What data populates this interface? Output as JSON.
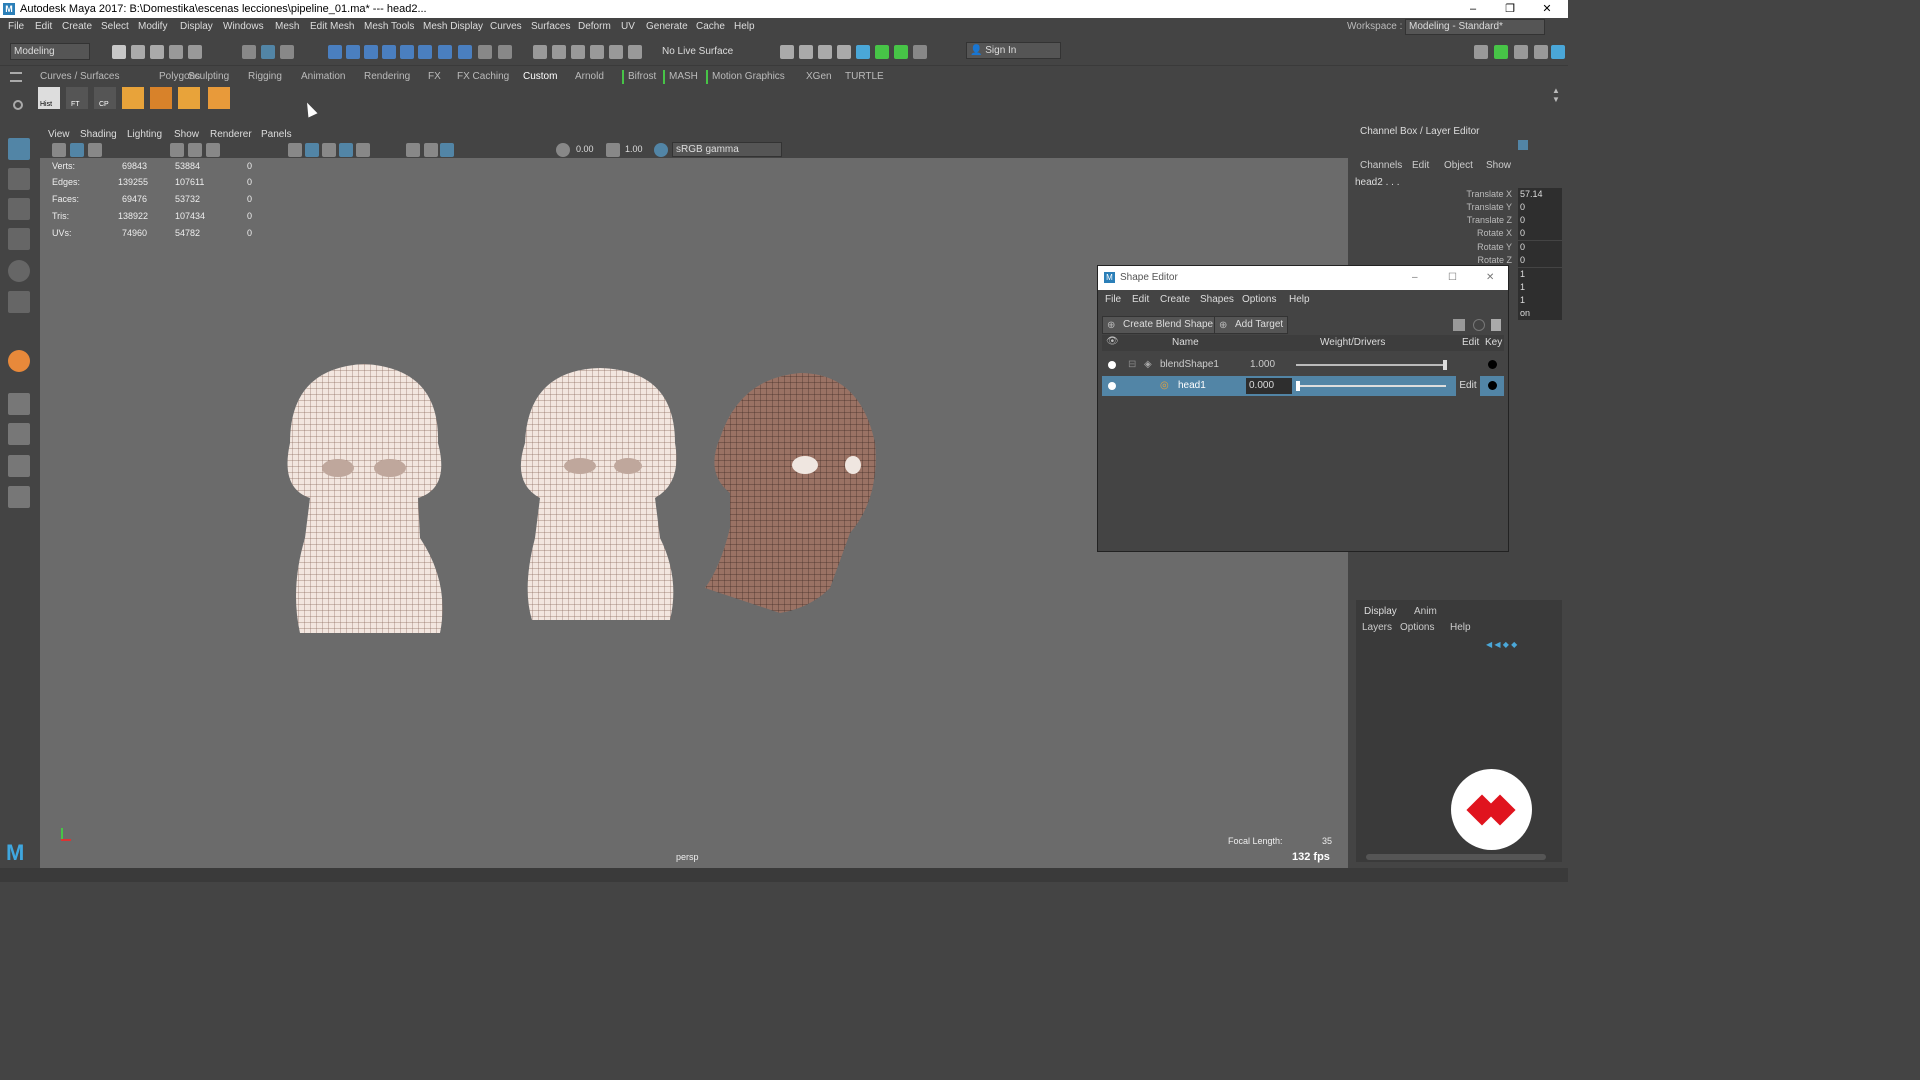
{
  "window": {
    "title": "Autodesk Maya 2017: B:\\Domestika\\escenas lecciones\\pipeline_01.ma*   ---   head2...",
    "logo": "M",
    "buttons": {
      "min": "–",
      "restore": "❐",
      "close": "✕"
    }
  },
  "menubar": {
    "items": [
      "File",
      "Edit",
      "Create",
      "Select",
      "Modify",
      "Display",
      "Windows",
      "Mesh",
      "Edit Mesh",
      "Mesh Tools",
      "Mesh Display",
      "Curves",
      "Surfaces",
      "Deform",
      "UV",
      "Generate",
      "Cache",
      "Help"
    ],
    "workspace_label": "Workspace :",
    "workspace_value": "Modeling - Standard*"
  },
  "toolbar": {
    "mode": "Modeling",
    "live_surface": "No Live Surface",
    "sign_in": "Sign In"
  },
  "shelf": {
    "tabs": [
      "Curves / Surfaces",
      "Polygons",
      "Sculpting",
      "Rigging",
      "Animation",
      "Rendering",
      "FX",
      "FX Caching",
      "Custom",
      "Arnold",
      "Bifrost",
      "MASH",
      "Motion Graphics",
      "XGen",
      "TURTLE"
    ],
    "active_tab": "Custom",
    "icons": [
      "Hist",
      "FT",
      "CP",
      "",
      "",
      "",
      ""
    ]
  },
  "viewport": {
    "menu": [
      "View",
      "Shading",
      "Lighting",
      "Show",
      "Renderer",
      "Panels"
    ],
    "exposure": "0.00",
    "gamma": "1.00",
    "colorspace": "sRGB gamma",
    "hud": {
      "rows": [
        {
          "label": "Verts:",
          "a": "69843",
          "b": "53884",
          "c": "0"
        },
        {
          "label": "Edges:",
          "a": "139255",
          "b": "107611",
          "c": "0"
        },
        {
          "label": "Faces:",
          "a": "69476",
          "b": "53732",
          "c": "0"
        },
        {
          "label": "Tris:",
          "a": "138922",
          "b": "107434",
          "c": "0"
        },
        {
          "label": "UVs:",
          "a": "74960",
          "b": "54782",
          "c": "0"
        }
      ]
    },
    "camera": "persp",
    "focal_label": "Focal Length:",
    "focal_value": "35",
    "fps": "132 fps"
  },
  "channelbox": {
    "title": "Channel Box / Layer Editor",
    "menu": [
      "Channels",
      "Edit",
      "Object",
      "Show"
    ],
    "object": "head2 . . .",
    "attrs": [
      {
        "name": "Translate X",
        "value": "57.14"
      },
      {
        "name": "Translate Y",
        "value": "0"
      },
      {
        "name": "Translate Z",
        "value": "0"
      },
      {
        "name": "Rotate X",
        "value": "0"
      },
      {
        "name": "Rotate Y",
        "value": "0"
      },
      {
        "name": "Rotate Z",
        "value": "0"
      }
    ],
    "extra_values": [
      "1",
      "1",
      "1",
      "on"
    ]
  },
  "layers": {
    "tabs": [
      "Display",
      "Anim"
    ],
    "menu": [
      "Layers",
      "Options",
      "Help"
    ]
  },
  "shape_editor": {
    "title": "Shape Editor",
    "menu": [
      "File",
      "Edit",
      "Create",
      "Shapes",
      "Options",
      "Help"
    ],
    "create_blend": "Create Blend Shape",
    "add_target": "Add Target",
    "columns": {
      "name": "Name",
      "weight": "Weight/Drivers",
      "edit": "Edit",
      "key": "Key"
    },
    "rows": [
      {
        "name": "blendShape1",
        "weight": "1.000",
        "weight_fraction": 1.0,
        "edit": ""
      },
      {
        "name": "head1",
        "weight": "0.000",
        "weight_fraction": 0.0,
        "edit": "Edit"
      }
    ]
  },
  "colors": {
    "accent": "#5285a6",
    "bg": "#444444",
    "viewport": "#6b6b6b",
    "badge_red": "#e0141e",
    "ui_green": "#47c447"
  }
}
